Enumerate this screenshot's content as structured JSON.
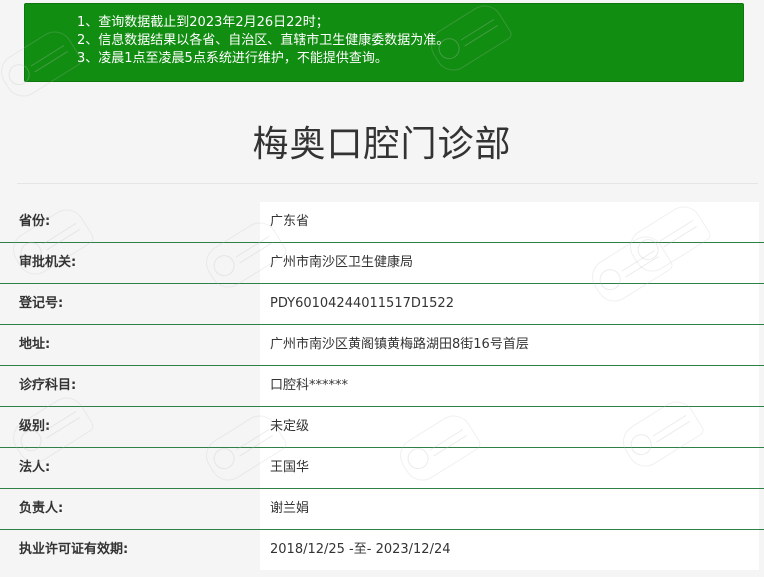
{
  "notice": {
    "lines": [
      "1、查询数据截止到2023年2月26日22时；",
      "2、信息数据结果以各省、自治区、直辖市卫生健康委数据为准。",
      "3、凌晨1点至凌晨5点系统进行维护，不能提供查询。"
    ],
    "background_color": "#118d11"
  },
  "clinic": {
    "name": "梅奥口腔门诊部"
  },
  "details": [
    {
      "label": "省份:",
      "value": "广东省"
    },
    {
      "label": "审批机关:",
      "value": "广州市南沙区卫生健康局"
    },
    {
      "label": "登记号:",
      "value": "PDY60104244011517D1522"
    },
    {
      "label": "地址:",
      "value": "广州市南沙区黄阁镇黄梅路湖田8街16号首层"
    },
    {
      "label": "诊疗科目:",
      "value": "口腔科******"
    },
    {
      "label": "级别:",
      "value": "未定级"
    },
    {
      "label": "法人:",
      "value": "王国华"
    },
    {
      "label": "负责人:",
      "value": "谢兰娟"
    },
    {
      "label": "执业许可证有效期:",
      "value": "2018/12/25 -至- 2023/12/24"
    }
  ],
  "style": {
    "row_divider_color": "#2f7f48",
    "value_background": "#ffffff",
    "label_background": "#f5f5f5"
  }
}
